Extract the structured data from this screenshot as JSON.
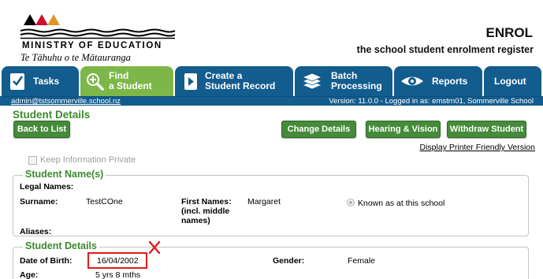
{
  "header": {
    "ministry": "MINISTRY OF EDUCATION",
    "maori_name": "Te Tāhuhu o te Mātauranga",
    "app_name": "ENROL",
    "tagline": "the school student enrolment register"
  },
  "nav": {
    "tasks": "Tasks",
    "find_student": "Find\na Student",
    "create_record": "Create a\nStudent Record",
    "batch": "Batch\nProcessing",
    "reports": "Reports",
    "logout": "Logout",
    "active": "find_student"
  },
  "status": {
    "user_email": "admin@tstsommerville.school.nz",
    "version": "Version: 11.0.0 - Logged in as: emstrn01, Sommerville School"
  },
  "page": {
    "title": "Student Details",
    "back_button": "Back to List",
    "change_details_button": "Change Details",
    "hearing_vision_button": "Hearing & Vision",
    "withdraw_button": "Withdraw Student",
    "printer_link": "Display Printer Friendly Version",
    "keep_private_label": "Keep Information Private",
    "keep_private_checked": false
  },
  "student_names": {
    "legend": "Student Name(s)",
    "legal_names_label": "Legal Names:",
    "surname_label": "Surname:",
    "surname_value": "TestCOne",
    "first_names_label": "First Names:\n(incl. middle\nnames)",
    "first_names_value": "Margaret",
    "known_as_label": "Known as at this school",
    "aliases_label": "Aliases:"
  },
  "student_details": {
    "legend": "Student Details",
    "dob_label": "Date of Birth:",
    "dob_value": "16/04/2002",
    "gender_label": "Gender:",
    "gender_value": "Female",
    "age_label": "Age:",
    "age_value": "5 yrs 8 mths"
  },
  "colors": {
    "nav_blue": "#135c8e",
    "nav_active_green": "#7eb749",
    "button_green": "#458b3a",
    "title_green": "#3c8a2d",
    "highlight_red": "#e01b1b"
  },
  "icons": {
    "tasks": "checkmark-document-icon",
    "find_student": "magnifier-plus-icon",
    "create_record": "play-document-icon",
    "batch": "stacked-documents-icon",
    "reports": "eye-icon",
    "annotation": "red-x-icon"
  }
}
